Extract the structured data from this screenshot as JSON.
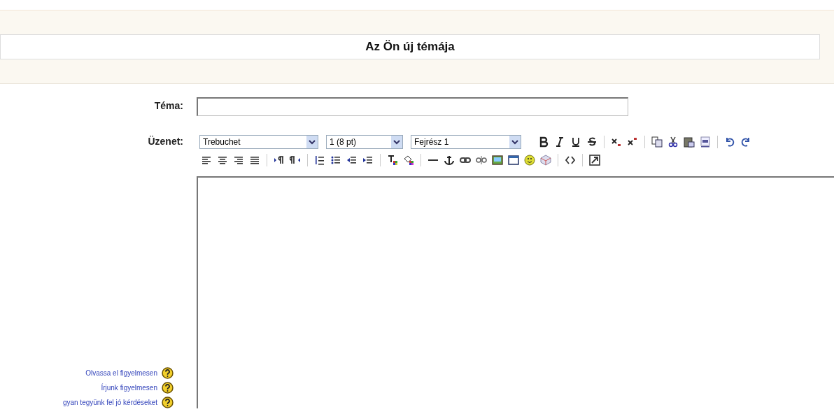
{
  "header": {
    "title": "Az Ön új témája"
  },
  "subject": {
    "label": "Téma:"
  },
  "message": {
    "label": "Üzenet:",
    "selects": [
      {
        "kind": "font",
        "value": "Trebuchet"
      },
      {
        "kind": "size",
        "value": "1 (8 pt)"
      },
      {
        "kind": "format",
        "value": "Fejrész 1"
      }
    ],
    "toolbar_row_1": [
      {
        "kind": "bold"
      },
      {
        "kind": "italic"
      },
      {
        "kind": "underline"
      },
      {
        "kind": "strike"
      },
      {
        "kind": "separator"
      },
      {
        "kind": "subscript"
      },
      {
        "kind": "superscript"
      },
      {
        "kind": "separator"
      },
      {
        "kind": "copy"
      },
      {
        "kind": "cut"
      },
      {
        "kind": "paste"
      },
      {
        "kind": "paste-word"
      },
      {
        "kind": "separator"
      },
      {
        "kind": "undo"
      },
      {
        "kind": "redo"
      }
    ],
    "toolbar_row_2": [
      {
        "kind": "align-left"
      },
      {
        "kind": "align-center"
      },
      {
        "kind": "align-right"
      },
      {
        "kind": "justify"
      },
      {
        "kind": "separator"
      },
      {
        "kind": "ltr"
      },
      {
        "kind": "rtl"
      },
      {
        "kind": "separator"
      },
      {
        "kind": "ordered-list"
      },
      {
        "kind": "bullet-list"
      },
      {
        "kind": "outdent"
      },
      {
        "kind": "indent"
      },
      {
        "kind": "separator"
      },
      {
        "kind": "text-color"
      },
      {
        "kind": "fill-color"
      },
      {
        "kind": "separator"
      },
      {
        "kind": "rule"
      },
      {
        "kind": "anchor"
      },
      {
        "kind": "link"
      },
      {
        "kind": "unlink"
      },
      {
        "kind": "image"
      },
      {
        "kind": "table"
      },
      {
        "kind": "smiley"
      },
      {
        "kind": "cube"
      },
      {
        "kind": "separator"
      },
      {
        "kind": "code"
      },
      {
        "kind": "separator"
      },
      {
        "kind": "fullscreen"
      }
    ]
  },
  "help_links": [
    {
      "label": "Olvassa el figyelmesen"
    },
    {
      "label": "Írjunk figyelmesen"
    },
    {
      "label": "gyan tegyünk fel jó kérdéseket"
    }
  ]
}
